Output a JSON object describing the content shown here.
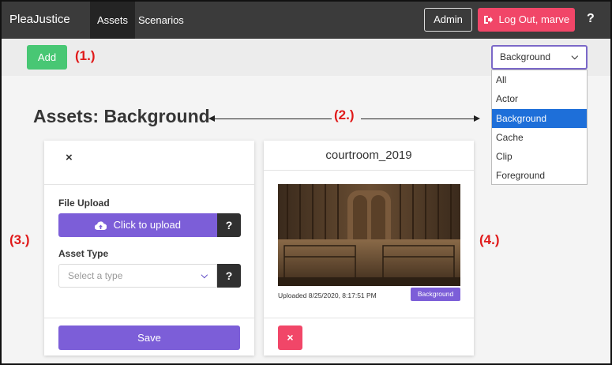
{
  "navbar": {
    "brand": "PleaJustice",
    "links": [
      {
        "label": "Assets",
        "active": true
      },
      {
        "label": "Scenarios",
        "active": false
      }
    ],
    "admin_label": "Admin",
    "logout_label": "Log Out, marve",
    "help_label": "?"
  },
  "toolbar": {
    "add_label": "Add",
    "filter_selected": "Background"
  },
  "dropdown": {
    "options": [
      "All",
      "Actor",
      "Background",
      "Cache",
      "Clip",
      "Foreground"
    ],
    "selected": "Background"
  },
  "annotations": {
    "a1": "(1.)",
    "a2": "(2.)",
    "a3": "(3.)",
    "a4": "(4.)"
  },
  "page_title": "Assets: Background",
  "upload_card": {
    "close_label": "×",
    "file_upload_label": "File Upload",
    "upload_button_label": "Click to upload",
    "help_label": "?",
    "asset_type_label": "Asset Type",
    "asset_type_placeholder": "Select a type",
    "save_label": "Save"
  },
  "asset_card": {
    "name": "courtroom_2019",
    "uploaded": "Uploaded 8/25/2020, 8:17:51 PM",
    "type_badge": "Background",
    "delete_label": "×"
  },
  "colors": {
    "navbar": "#3b3b3b",
    "primary": "#7c5ed8",
    "success": "#48c774",
    "danger": "#f14668",
    "annotation": "#e01a1a",
    "selection": "#1e6fd9"
  },
  "icons": {
    "logout": "sign-out-icon",
    "upload": "cloud-upload-icon",
    "chevron": "chevron-down-icon"
  }
}
